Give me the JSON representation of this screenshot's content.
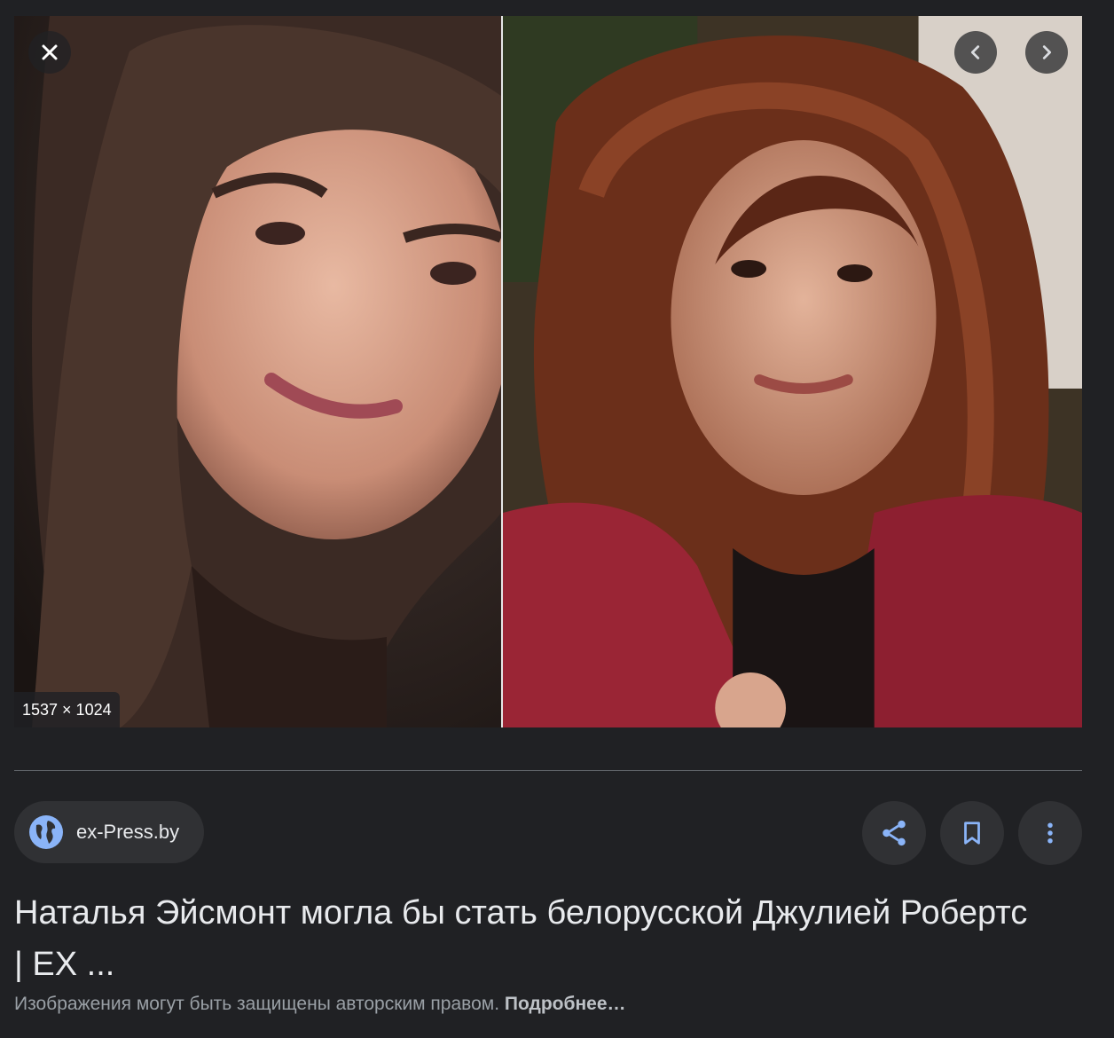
{
  "viewer": {
    "dimensions": "1537 × 1024",
    "close_icon": "close-icon",
    "prev_icon": "chevron-left-icon",
    "next_icon": "chevron-right-icon"
  },
  "source": {
    "label": "ex-Press.by",
    "icon": "globe-icon"
  },
  "actions": {
    "share_icon": "share-icon",
    "save_icon": "bookmark-icon",
    "more_icon": "more-vert-icon"
  },
  "result": {
    "title": "Наталья Эйсмонт могла бы стать белорусской Джулией Робертс | EX ...",
    "copyright_text": "Изображения могут быть защищены авторским правом.",
    "learn_more": "Подробнее…"
  },
  "colors": {
    "background": "#202124",
    "chip": "#303134",
    "accent_blue": "#8ab4f8",
    "text_primary": "#e8eaed",
    "text_secondary": "#9aa0a6"
  }
}
